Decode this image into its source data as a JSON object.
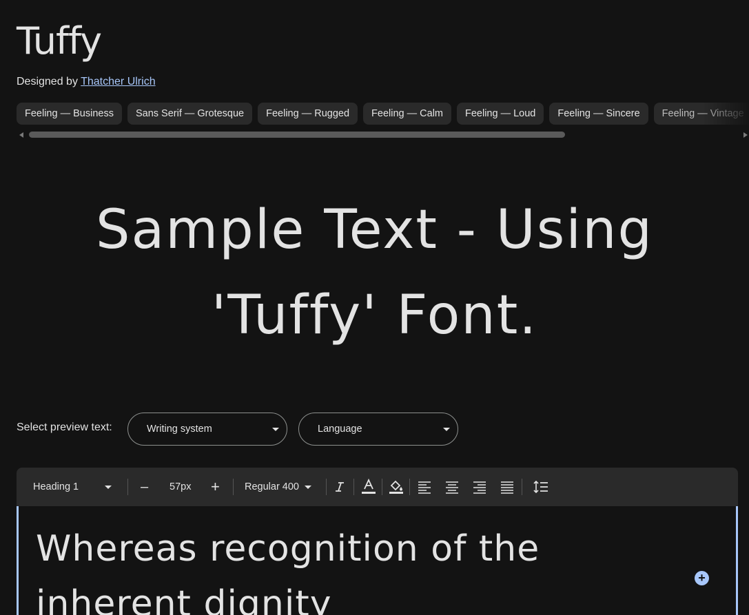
{
  "font": {
    "name": "Tuffy",
    "designed_by_prefix": "Designed by",
    "designer": "Thatcher Ulrich"
  },
  "tags": [
    "Feeling — Business",
    "Sans Serif — Grotesque",
    "Feeling — Rugged",
    "Feeling — Calm",
    "Feeling — Loud",
    "Feeling — Sincere",
    "Feeling — Vintage"
  ],
  "sample_text": "Sample Text - Using 'Tuffy' Font.",
  "preview": {
    "label": "Select preview text:",
    "writing_system": "Writing system",
    "language": "Language"
  },
  "toolbar": {
    "style": "Heading 1",
    "decrease": "–",
    "size": "57px",
    "increase": "+",
    "weight": "Regular 400"
  },
  "editor": {
    "text": "Whereas recognition of the inherent dignity"
  },
  "colors": {
    "background": "#131313",
    "text": "#e3e3e3",
    "link": "#a8c7fa",
    "chip": "#2a2a2a",
    "accent": "#a8c7fa"
  },
  "icons": {
    "italic": "italic-icon",
    "text_color": "text-color-icon",
    "highlight": "fill-color-icon",
    "align_left": "align-left-icon",
    "align_center": "align-center-icon",
    "align_right": "align-right-icon",
    "align_justify": "align-justify-icon",
    "line_spacing": "line-spacing-icon",
    "add": "add-circle-icon"
  }
}
